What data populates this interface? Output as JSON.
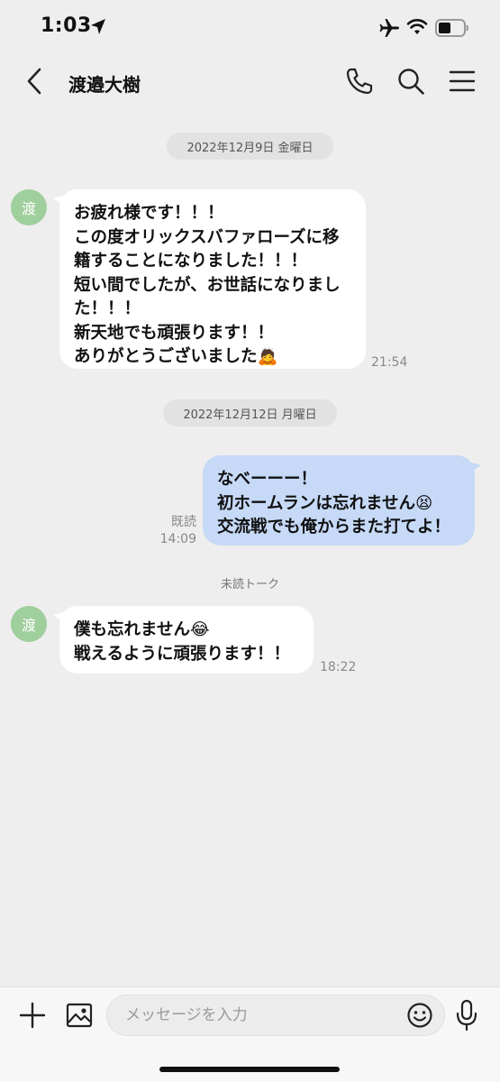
{
  "status_bar": {
    "time": "1:03"
  },
  "header": {
    "title": "渡邉大樹"
  },
  "date_separators": [
    "2022年12月9日 金曜日",
    "2022年12月12日 月曜日"
  ],
  "unread_divider": "未読トーク",
  "contact": {
    "avatar_text": "渡"
  },
  "messages": [
    {
      "direction": "incoming",
      "text": "お疲れ様です！！！\nこの度オリックスバファローズに移籍することになりました！！！\n短い間でしたが、お世話になりました！！！\n新天地でも頑張ります！！\nありがとうございました🙇",
      "time": "21:54"
    },
    {
      "direction": "outgoing",
      "text": "なべーーー！\n初ホームランは忘れません😫\n交流戦でも俺からまた打てよ！",
      "read": "既読",
      "time": "14:09"
    },
    {
      "direction": "incoming",
      "text": "僕も忘れません😂\n戦えるように頑張ります！！",
      "time": "18:22"
    }
  ],
  "input": {
    "placeholder": "メッセージを入力"
  },
  "colors": {
    "background": "#eeeeee",
    "incoming_bubble": "#ffffff",
    "outgoing_bubble": "#c6d9f7",
    "avatar": "#9fcf9c"
  },
  "icons": [
    "location-arrow-icon",
    "airplane-icon",
    "wifi-icon",
    "battery-icon",
    "back-icon",
    "phone-icon",
    "search-icon",
    "menu-icon",
    "plus-icon",
    "image-icon",
    "emoji-icon",
    "mic-icon"
  ]
}
